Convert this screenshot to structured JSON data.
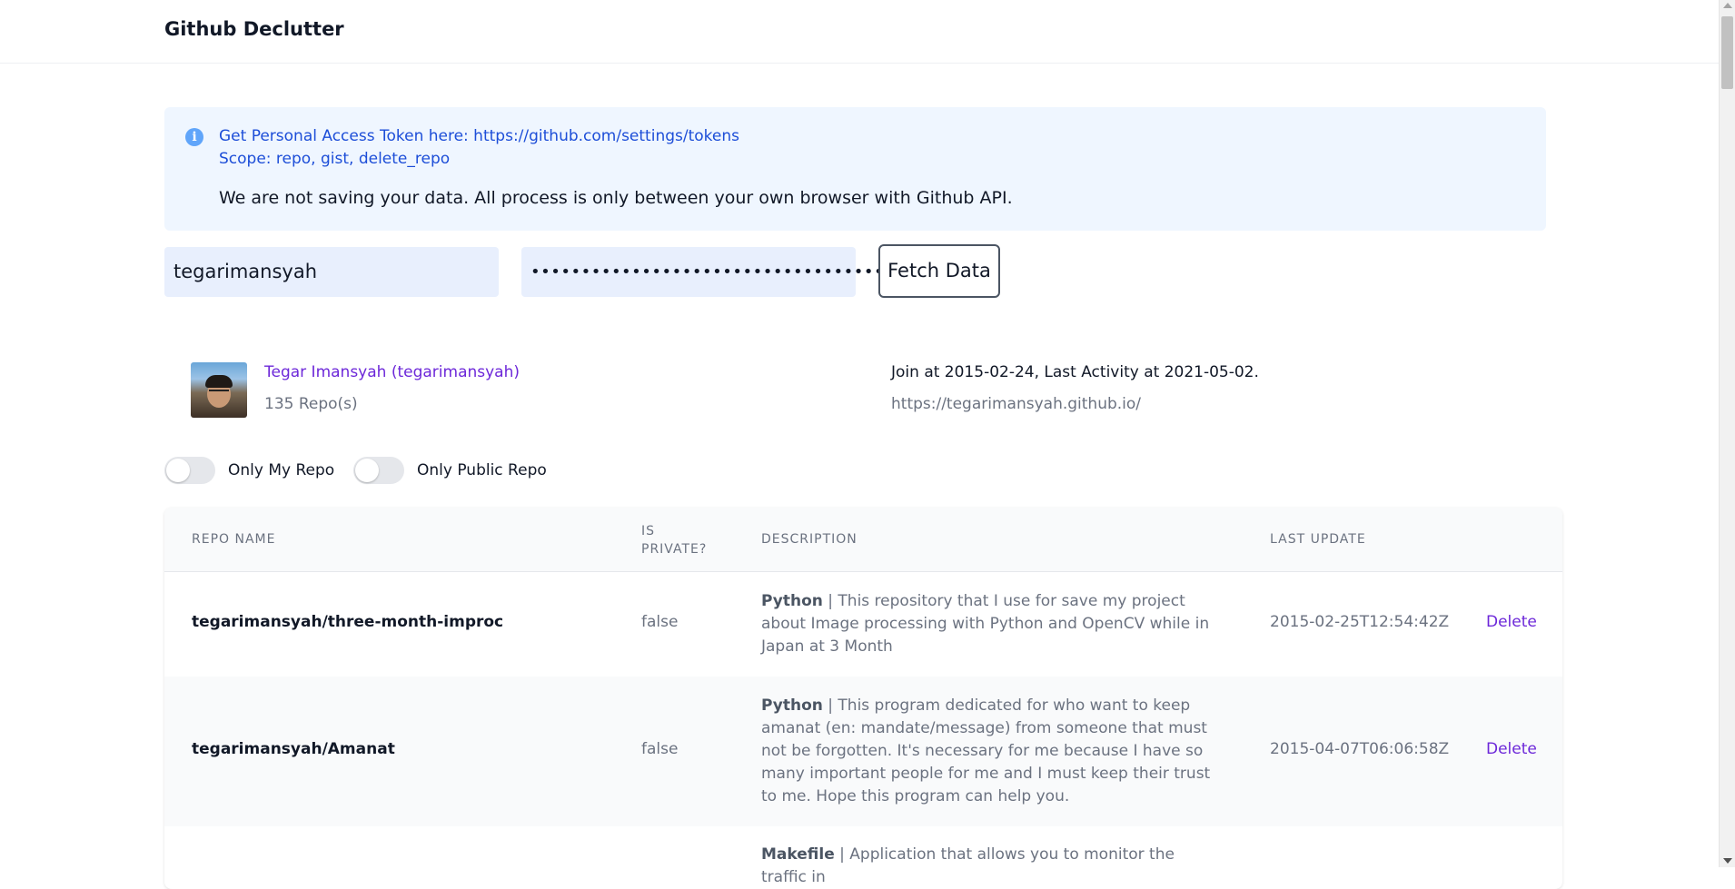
{
  "header": {
    "title": "Github Declutter"
  },
  "info": {
    "icon": "info-icon",
    "line1": "Get Personal Access Token here: https://github.com/settings/tokens",
    "line2": "Scope: repo, gist, delete_repo",
    "note": "We are not saving your data. All process is only between your own browser with Github API."
  },
  "form": {
    "username_value": "tegarimansyah",
    "token_value": "••••••••••••••••••••••••••••••••••••••••",
    "fetch_label": "Fetch Data"
  },
  "profile": {
    "name": "Tegar Imansyah (tegarimansyah)",
    "repo_count": "135 Repo(s)",
    "dates": "Join at 2015-02-24, Last Activity at 2021-05-02.",
    "url": "https://tegarimansyah.github.io/"
  },
  "filters": {
    "only_my_repo": {
      "label": "Only My Repo",
      "on": false
    },
    "only_public_repo": {
      "label": "Only Public Repo",
      "on": false
    }
  },
  "table": {
    "headers": {
      "name": "REPO NAME",
      "private": "IS PRIVATE?",
      "description": "DESCRIPTION",
      "last_update": "LAST UPDATE"
    },
    "rows": [
      {
        "name": "tegarimansyah/three-month-improc",
        "private": "false",
        "language": "Python",
        "description": " | This repository that I use for save my project about Image processing with Python and OpenCV while in Japan at 3 Month",
        "last_update": "2015-02-25T12:54:42Z",
        "action": "Delete"
      },
      {
        "name": "tegarimansyah/Amanat",
        "private": "false",
        "language": "Python",
        "description": " | This program dedicated for who want to keep amanat (en: mandate/message) from someone that must not be forgotten. It's necessary for me because I have so many important people for me and I must keep their trust to me. Hope this program can help you.",
        "last_update": "2015-04-07T06:06:58Z",
        "action": "Delete"
      },
      {
        "name": "",
        "private": "",
        "language": "Makefile",
        "description": " | Application that allows you to monitor the traffic in",
        "last_update": "",
        "action": ""
      }
    ]
  }
}
